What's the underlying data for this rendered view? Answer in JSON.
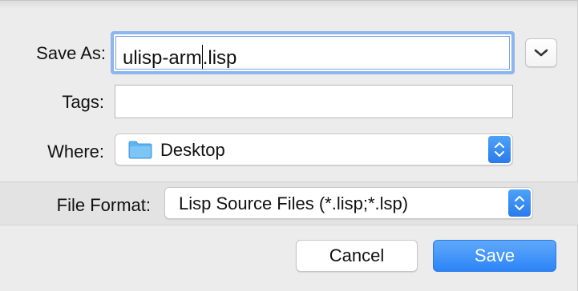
{
  "dialog": {
    "save_as": {
      "label": "Save As:",
      "value_before_cursor": "ulisp-arm",
      "value_after_cursor": ".lisp"
    },
    "tags": {
      "label": "Tags:",
      "value": ""
    },
    "where": {
      "label": "Where:",
      "selected": "Desktop",
      "icon": "folder-icon"
    },
    "file_format": {
      "label": "File Format:",
      "selected": "Lisp Source Files (*.lisp;*.lsp)"
    },
    "buttons": {
      "cancel": "Cancel",
      "save": "Save"
    },
    "colors": {
      "accent": "#2c84f7",
      "focus_ring": "#8db5ee",
      "folder": "#5fb4ee"
    }
  }
}
